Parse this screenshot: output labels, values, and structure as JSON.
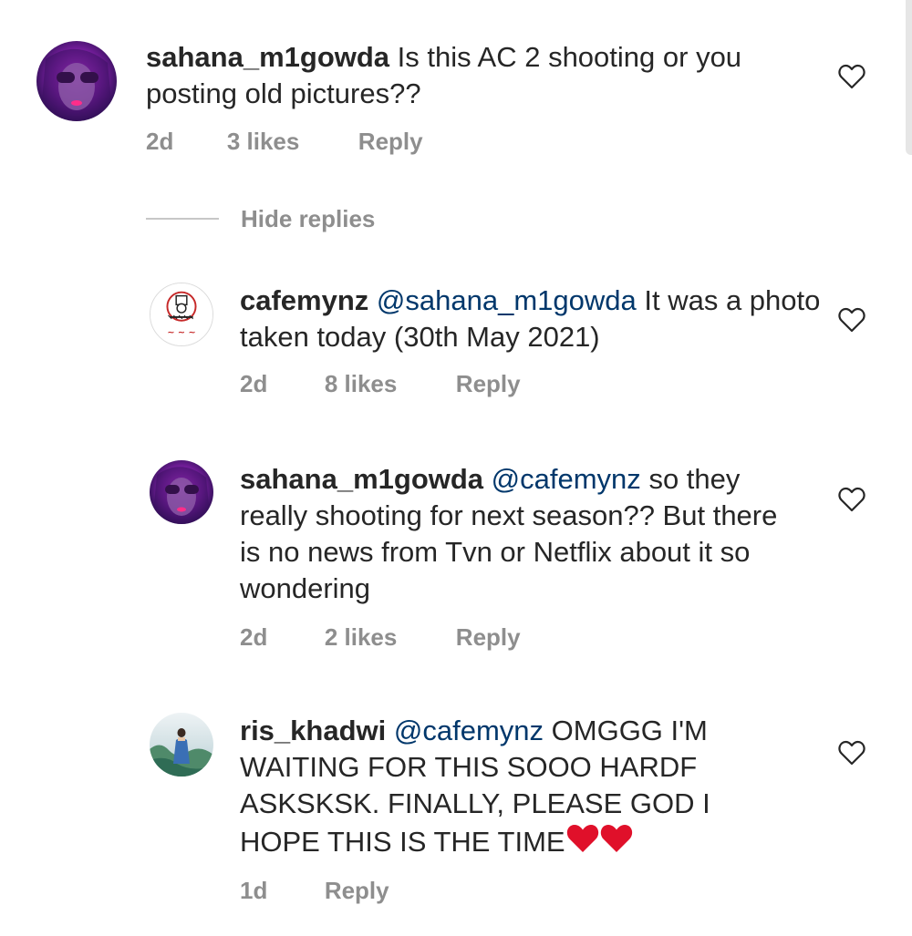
{
  "comments": [
    {
      "username": "sahana_m1gowda",
      "mention": "",
      "text": "Is this AC 2 shooting or you posting old pictures??",
      "time": "2d",
      "likes": "3 likes",
      "reply": "Reply",
      "avatar": "purple-profile-photo"
    },
    {
      "username": "cafemynz",
      "mention": "@sahana_m1gowda",
      "text": "It was a photo taken today (30th May 2021)",
      "time": "2d",
      "likes": "8 likes",
      "reply": "Reply",
      "avatar": "cafe-logo"
    },
    {
      "username": "sahana_m1gowda",
      "mention": "@cafemynz",
      "text": "so they really shooting for next season?? But there is no news from Tvn or Netflix about it so wondering",
      "time": "2d",
      "likes": "2 likes",
      "reply": "Reply",
      "avatar": "purple-profile-photo"
    },
    {
      "username": "ris_khadwi",
      "mention": "@cafemynz",
      "text": "OMGGG I'M WAITING FOR THIS SOOO HARDF ASKSKSK. FINALLY, PLEASE GOD I HOPE THIS IS THE TIME",
      "emoji": "❤❤",
      "time": "1d",
      "likes": "",
      "reply": "Reply",
      "avatar": "landscape-photo"
    }
  ],
  "hide_replies": "Hide replies",
  "icons": {
    "like": "heart-outline-icon"
  },
  "colors": {
    "text": "#262626",
    "meta": "#8e8e8e",
    "mention": "#00376b",
    "emoji_heart": "#e0102a"
  }
}
